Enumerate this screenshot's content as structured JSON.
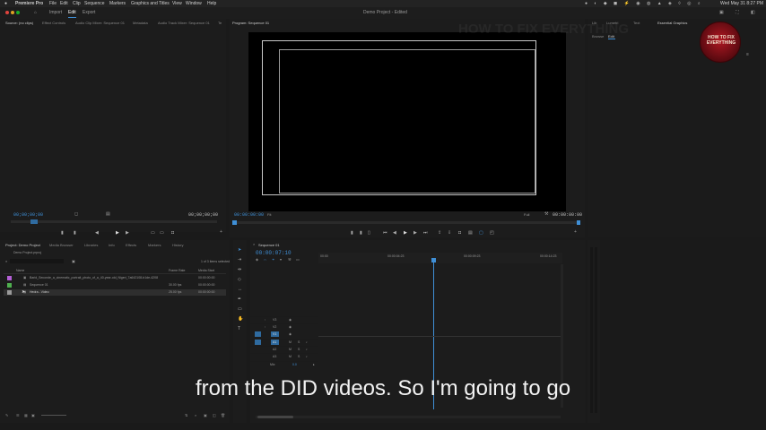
{
  "menu": {
    "apple": "",
    "app_name": "Premiere Pro",
    "items": [
      "File",
      "Edit",
      "Clip",
      "Sequence",
      "Markers",
      "Graphics and Titles",
      "View",
      "Window",
      "Help"
    ],
    "clock": "Wed May 31  8:27 PM"
  },
  "workspace": {
    "tabs": [
      "Import",
      "Edit",
      "Export"
    ],
    "active_tab": "Edit",
    "project_title": "Demo Project - Edited"
  },
  "source_panel": {
    "tabs": [
      "Source: (no clips)",
      "Effect Controls",
      "Audio Clip Mixer: Sequence 01",
      "Metadata",
      "Audio Track Mixer: Sequence 01",
      "Te"
    ],
    "timecode_left": "00;00;00;00",
    "timecode_right": "00;00;00;00"
  },
  "program_panel": {
    "title": "Program: Sequence 01",
    "timecode_left": "00:00:00:00",
    "fit": "Fit",
    "quality": "Full",
    "timecode_right": "00:00:00:00"
  },
  "right_panel": {
    "tabs": [
      "Lib",
      "Lumetri",
      "Text",
      "Essential Graphics"
    ],
    "subtabs": [
      "Browse",
      "Edit"
    ],
    "active_subtab": "Edit"
  },
  "watermark": {
    "text": "HOW TO FIX EVERYTHING",
    "logo_text": "HOW TO FIX EVERYTHING"
  },
  "project_panel": {
    "tabs": [
      "Project: Demo Project",
      "Media Browser",
      "Libraries",
      "Info",
      "Effects",
      "Markers",
      "History"
    ],
    "path": "Demo Project.prproj",
    "selection": "1 of 3 items selected",
    "columns": [
      "Name",
      "Frame Rate",
      "Media Start"
    ],
    "items": [
      {
        "name": "Barid_Seconde_a_cinematic_portrait_photo_of_a_40-year-old_Nigeri_7a642108-b1de-4208",
        "rate": "",
        "start": "00:00:00:00",
        "color": "#b460d6"
      },
      {
        "name": "Sequence 01",
        "rate": "30.00 fps",
        "start": "00:00:00:00",
        "color": "#4fb04f"
      },
      {
        "name": "Hedra - Video",
        "rate": "25.00 fps",
        "start": "00:00:00:00",
        "color": "#9a9a9a"
      }
    ]
  },
  "timeline": {
    "tab": "Sequence 01",
    "timecode": "00:00:07:10",
    "ruler": [
      "00:00",
      "00:00:04:23",
      "00:00:09:23",
      "00:00:14:23"
    ],
    "video_tracks": [
      "V3",
      "V2",
      "V1"
    ],
    "audio_tracks": [
      "A1",
      "A2",
      "A3"
    ],
    "mix_label": "Mix",
    "mix_value": "0.0"
  },
  "caption": "from the DID videos. So I'm going to go",
  "colors": {
    "accent": "#3f8fd6",
    "panel_bg": "#1e1e1e",
    "logo_red": "#8b0f1a"
  }
}
